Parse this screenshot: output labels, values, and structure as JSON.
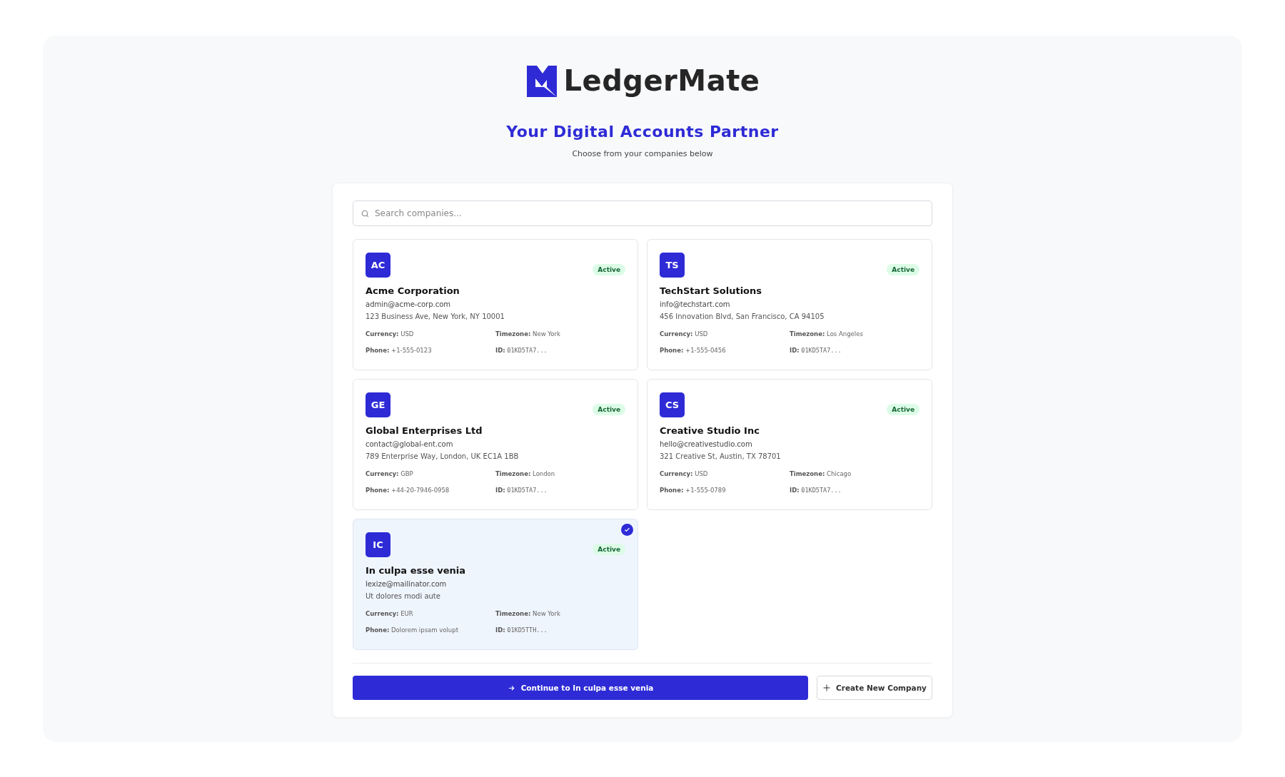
{
  "brand": {
    "name": "LedgerMate"
  },
  "header": {
    "title": "Your Digital Accounts Partner",
    "subtitle": "Choose from your companies below"
  },
  "search": {
    "placeholder": "Search companies..."
  },
  "companies": [
    {
      "initials": "AC",
      "name": "Acme Corporation",
      "email": "admin@acme-corp.com",
      "address": "123 Business Ave, New York, NY 10001",
      "status": "Active",
      "selected": false,
      "details": [
        {
          "label": "Currency:",
          "value": "USD",
          "kind": "text"
        },
        {
          "label": "Timezone:",
          "value": "New York",
          "kind": "text"
        },
        {
          "label": "Phone:",
          "value": "+1-555-0123",
          "kind": "text"
        },
        {
          "label": "ID:",
          "value": "01KD5TA7...",
          "kind": "mono"
        }
      ]
    },
    {
      "initials": "TS",
      "name": "TechStart Solutions",
      "email": "info@techstart.com",
      "address": "456 Innovation Blvd, San Francisco, CA 94105",
      "status": "Active",
      "selected": false,
      "details": [
        {
          "label": "Currency:",
          "value": "USD",
          "kind": "text"
        },
        {
          "label": "Timezone:",
          "value": "Los Angeles",
          "kind": "text"
        },
        {
          "label": "Phone:",
          "value": "+1-555-0456",
          "kind": "text"
        },
        {
          "label": "ID:",
          "value": "01KD5TA7...",
          "kind": "mono"
        }
      ]
    },
    {
      "initials": "GE",
      "name": "Global Enterprises Ltd",
      "email": "contact@global-ent.com",
      "address": "789 Enterprise Way, London, UK EC1A 1BB",
      "status": "Active",
      "selected": false,
      "details": [
        {
          "label": "Currency:",
          "value": "GBP",
          "kind": "text"
        },
        {
          "label": "Timezone:",
          "value": "London",
          "kind": "text"
        },
        {
          "label": "Phone:",
          "value": "+44-20-7946-0958",
          "kind": "text"
        },
        {
          "label": "ID:",
          "value": "01KD5TA7...",
          "kind": "mono"
        }
      ]
    },
    {
      "initials": "CS",
      "name": "Creative Studio Inc",
      "email": "hello@creativestudio.com",
      "address": "321 Creative St, Austin, TX 78701",
      "status": "Active",
      "selected": false,
      "details": [
        {
          "label": "Currency:",
          "value": "USD",
          "kind": "text"
        },
        {
          "label": "Timezone:",
          "value": "Chicago",
          "kind": "text"
        },
        {
          "label": "Phone:",
          "value": "+1-555-0789",
          "kind": "text"
        },
        {
          "label": "ID:",
          "value": "01KD5TA7...",
          "kind": "mono"
        }
      ]
    },
    {
      "initials": "IC",
      "name": "In culpa esse venia",
      "email": "lexize@mailinator.com",
      "address": "Ut dolores modi aute",
      "status": "Active",
      "selected": true,
      "details": [
        {
          "label": "Currency:",
          "value": "EUR",
          "kind": "text"
        },
        {
          "label": "Timezone:",
          "value": "New York",
          "kind": "text"
        },
        {
          "label": "Phone:",
          "value": "Dolorem ipsam volupt",
          "kind": "text"
        },
        {
          "label": "ID:",
          "value": "01KD5TTH...",
          "kind": "mono"
        }
      ]
    }
  ],
  "actions": {
    "continue": "Continue to In culpa esse venia",
    "create": "Create New Company"
  }
}
